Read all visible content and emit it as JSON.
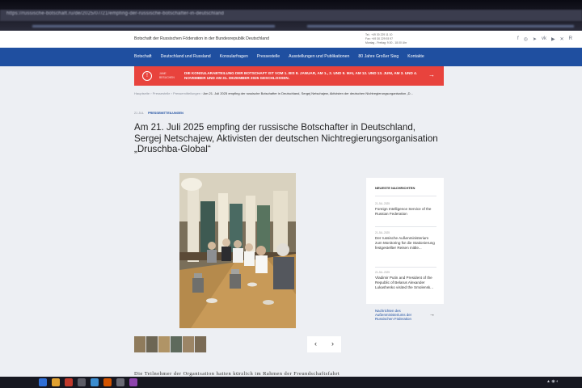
{
  "browser": {
    "address": "https://russische-botschaft.ru/de/2025/07/21/empfing-der-russische-botschafter-in-deutschland"
  },
  "header": {
    "org_name": "Botschaft der Russischen Föderation in der Bundesrepublik Deutschland",
    "contact_line1": "Tel.: +49 30 229 11 10",
    "contact_line2": "Fax: +49 30 229 93 97",
    "contact_line3": "Montag - Freitag: 9.00 - 18.00 Uhr",
    "social_icons": [
      "facebook-icon",
      "instagram-icon",
      "telegram-icon",
      "vk-icon",
      "youtube-icon",
      "x-icon",
      "rutube-icon"
    ]
  },
  "nav": {
    "items": [
      "Botschaft",
      "Deutschland und Russland",
      "Konsularfragen",
      "Pressestelle",
      "Ausstellungen und Publikationen",
      "80 Jahre Großer Sieg",
      "Kontakte"
    ]
  },
  "alert": {
    "label_line1": "JANE",
    "label_line2": "BESUCHEN",
    "message": "DIE KONSULARABTEILUNG DER BOTSCHAFT IST VOM 1. BIS 8. JANUAR, AM 1., 2. UND 9. MAI, AM 12. UND 13. JUNI, AM 3. UND 4. NOVEMBER UND AM 31. DEZEMBER 2025 GESCHLOSSEN.",
    "color": "#e8433d"
  },
  "breadcrumbs": {
    "items": [
      "Hauptseite",
      "Pressestelle",
      "Pressemitteilungen"
    ],
    "current": "Am 21. Juli 2025 empfing der russische Botschafter in Deutschland, Sergej Netschajew, Aktivisten der deutschen Nichtregierungsorganisation „D..."
  },
  "article": {
    "date": "21 JUL",
    "category": "PRESSEMITTEILUNGEN",
    "title": "Am 21. Juli 2025 empfing der russische Botschafter in Deutschland, Sergej Netschajew, Aktivisten der deutschen Nichtregierungsorganisation „Druschba-Global“",
    "body_start": "Die Teilnehmer der Organisation hatten kürzlich im Rahmen der Freundschaftsfahrt"
  },
  "gallery": {
    "prev_label": "‹",
    "next_label": "›"
  },
  "sidebar": {
    "heading": "NEUESTE NACHRICHTEN",
    "news": [
      {
        "date": "21.JUL.2025",
        "title": "Foreign Intelligence Service of the Russian Federation"
      },
      {
        "date": "21.JUL.2025",
        "title": "Der russische Außenministerium zum Monitoring für die Stationierung festgestellter Reisen mittle..."
      },
      {
        "date": "21.JUL.2025",
        "title": "Vladimir Putin and President of the Republic of Belarus Alexander Lukashenko visited the Smolensk..."
      }
    ],
    "more_link": "Nachrichten des Außenministeriums der Russischen Föderation"
  },
  "colors": {
    "nav_blue": "#1f4fa0",
    "page_bg": "#edeff3"
  }
}
